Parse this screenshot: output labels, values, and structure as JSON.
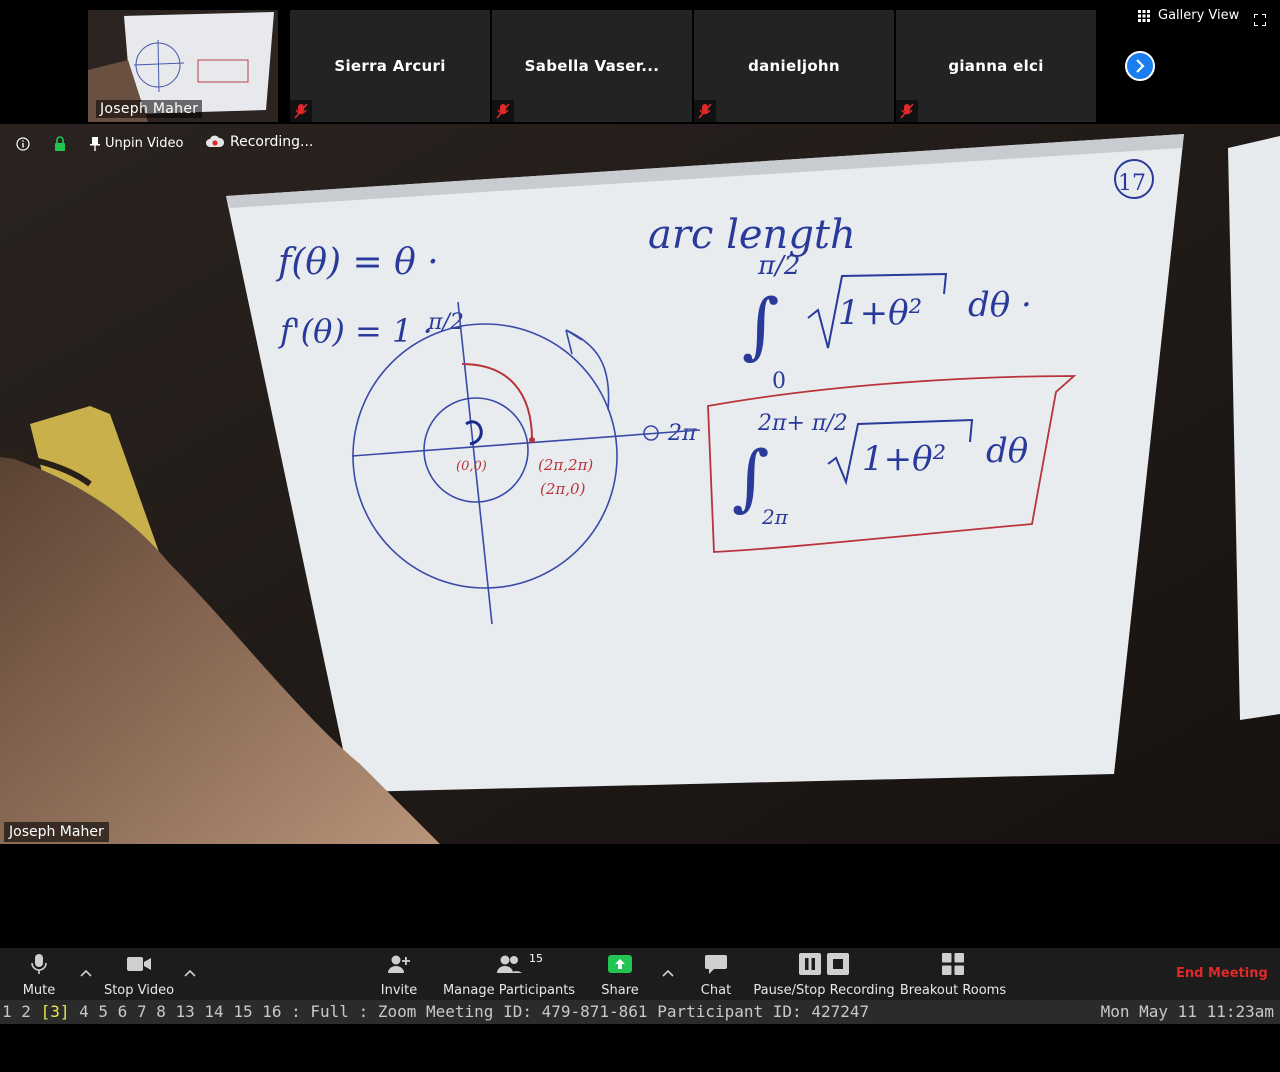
{
  "top_strip": {
    "thumbnails": [
      {
        "name": "Joseph Maher",
        "type": "video"
      },
      {
        "name": "Sierra Arcuri",
        "type": "name",
        "muted": true
      },
      {
        "name": "Sabella Vaser...",
        "type": "name",
        "muted": true
      },
      {
        "name": "danieljohn",
        "type": "name",
        "muted": true
      },
      {
        "name": "gianna elci",
        "type": "name",
        "muted": true
      }
    ],
    "gallery_view_label": "Gallery View"
  },
  "info_bar": {
    "unpin_label": "Unpin Video",
    "recording_label": "Recording..."
  },
  "main_video": {
    "speaker_name": "Joseph Maher",
    "whiteboard": {
      "page_number": "17",
      "line1": "f(θ) = θ ·",
      "line2": "f'(θ) = 1 ·",
      "heading": "arc length",
      "pi_over_2": "π/2",
      "two_pi": "2π",
      "origin_label": "(0,0)",
      "point_label_1": "(2π,2π)",
      "point_label_2": "(2π,0)",
      "integral1_upper": "π/2",
      "integral1_lower": "0",
      "integral1_body": "1+θ²",
      "integral1_d": "dθ ·",
      "integral2_upper": "2π+ π/2",
      "integral2_lower": "2π",
      "integral2_body": "1+θ²",
      "integral2_d": "dθ"
    }
  },
  "toolbar": {
    "mute_label": "Mute",
    "stop_video_label": "Stop Video",
    "invite_label": "Invite",
    "participants_label": "Manage Participants",
    "participants_count": "15",
    "share_label": "Share",
    "chat_label": "Chat",
    "recording_label": "Pause/Stop Recording",
    "breakout_label": "Breakout Rooms",
    "end_meeting_label": "End Meeting"
  },
  "status_bar": {
    "workspaces": [
      "1",
      "2",
      "3",
      "4",
      "5",
      "6",
      "7",
      "8",
      "13",
      "14",
      "15",
      "16"
    ],
    "active_workspace": "3",
    "layout_text": ": Full : Zoom Meeting ID: 479-871-861 Participant ID: 427247",
    "clock": "Mon May 11 11:23am"
  },
  "colors": {
    "accent_blue": "#1a7ef0",
    "share_green": "#23c552",
    "end_red": "#e02a2a",
    "ink_blue": "#2a3a9a",
    "ink_red": "#b8343a"
  }
}
